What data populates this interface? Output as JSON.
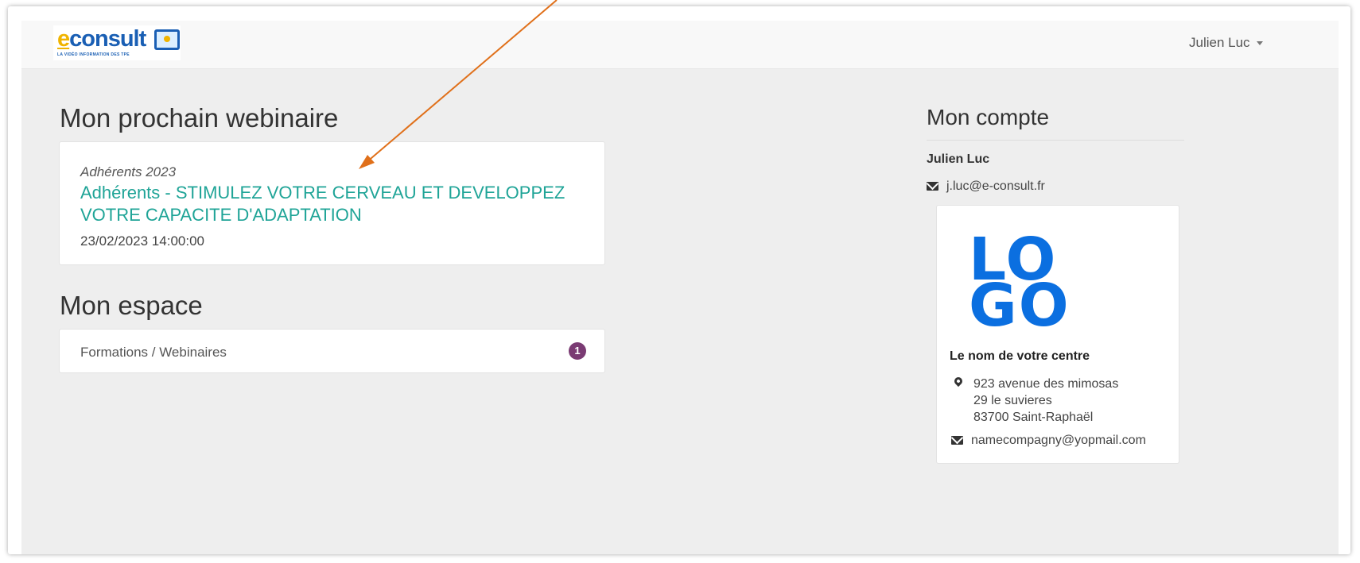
{
  "brand": {
    "logo_main": "consult",
    "logo_e": "e",
    "logo_tagline": "LA VIDÉO INFORMATION DES TPE"
  },
  "user_menu": {
    "label": "Julien Luc"
  },
  "webinaire": {
    "heading": "Mon prochain webinaire",
    "category": "Adhérents 2023",
    "title": "Adhérents - STIMULEZ VOTRE CERVEAU ET DEVELOPPEZ VOTRE CAPACITE D'ADAPTATION",
    "datetime": "23/02/2023 14:00:00"
  },
  "espace": {
    "heading": "Mon espace",
    "items": [
      {
        "label": "Formations / Webinaires",
        "count": "1"
      }
    ]
  },
  "compte": {
    "heading": "Mon compte",
    "name": "Julien Luc",
    "email": "j.luc@e-consult.fr"
  },
  "centre": {
    "logo_line1": "LO",
    "logo_line2": "GO",
    "name": "Le nom de votre centre",
    "address_lines": [
      "923 avenue des mimosas",
      "29 le suvieres",
      "83700 Saint-Raphaël"
    ],
    "email": "namecompagny@yopmail.com"
  },
  "colors": {
    "accent_link": "#1fa497",
    "badge": "#7a3b73",
    "logo_blue": "#0b6fe0",
    "annotation_arrow": "#e0701a"
  }
}
